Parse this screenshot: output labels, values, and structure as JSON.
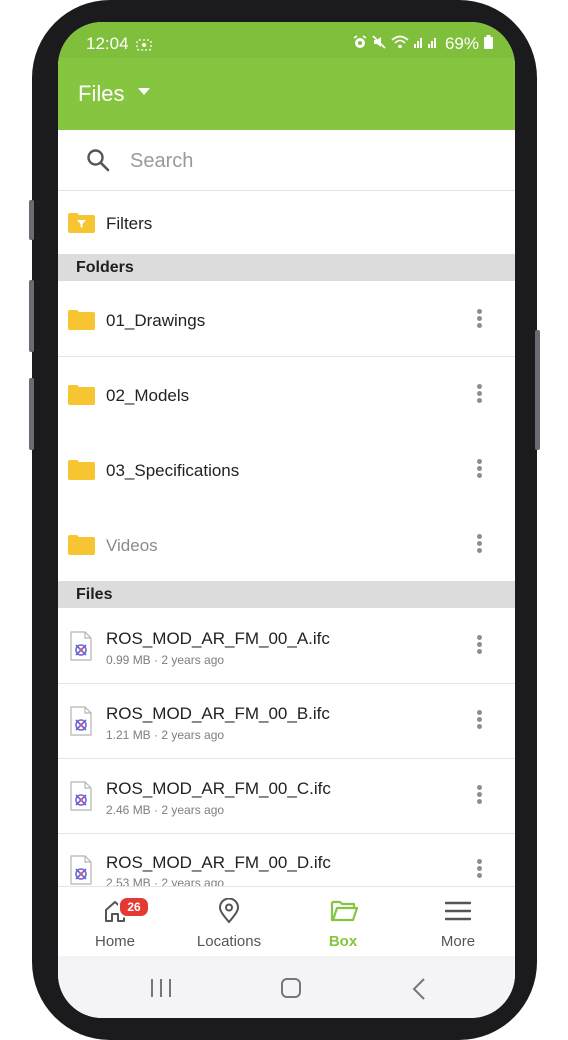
{
  "status_bar": {
    "time": "12:04",
    "battery": "69%"
  },
  "header": {
    "title": "Files"
  },
  "search": {
    "placeholder": "Search",
    "value": ""
  },
  "filters": {
    "label": "Filters"
  },
  "folders": {
    "header": "Folders",
    "items": [
      {
        "label": "01_Drawings"
      },
      {
        "label": "02_Models"
      },
      {
        "label": "03_Specifications"
      },
      {
        "label": "Videos"
      }
    ]
  },
  "files": {
    "header": "Files",
    "items": [
      {
        "name": "ROS_MOD_AR_FM_00_A.ifc",
        "meta": "0.99 MB · 2 years ago"
      },
      {
        "name": "ROS_MOD_AR_FM_00_B.ifc",
        "meta": "1.21 MB · 2 years ago"
      },
      {
        "name": "ROS_MOD_AR_FM_00_C.ifc",
        "meta": "2.46 MB · 2 years ago"
      },
      {
        "name": "ROS_MOD_AR_FM_00_D.ifc",
        "meta": "2.53 MB · 2 years ago"
      }
    ]
  },
  "bottom_nav": {
    "home": {
      "label": "Home",
      "badge": "26"
    },
    "locations": {
      "label": "Locations"
    },
    "box": {
      "label": "Box"
    },
    "more": {
      "label": "More"
    }
  },
  "colors": {
    "brand": "#86c540",
    "status_bar": "#7fbf3b",
    "folder": "#f7c531",
    "badge": "#e53935"
  }
}
